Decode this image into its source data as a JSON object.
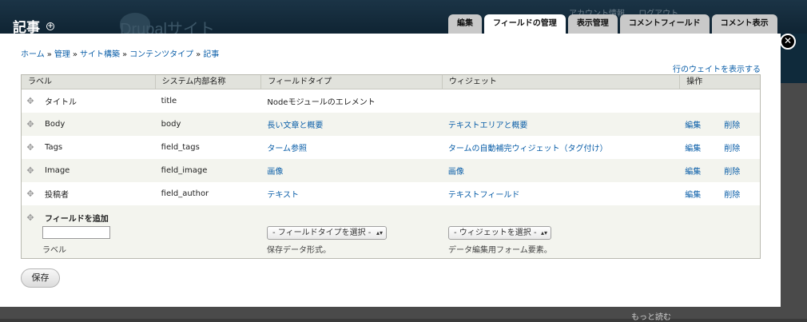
{
  "background": {
    "site_name": "Drupalサイト",
    "account_links": [
      "アカウント情報",
      "ログアウト"
    ],
    "read_more": "もっと読む"
  },
  "page": {
    "title": "記事",
    "shortcut_icon": "plus-circle-icon"
  },
  "tabs": [
    {
      "label": "編集",
      "active": false
    },
    {
      "label": "フィールドの管理",
      "active": true
    },
    {
      "label": "表示管理",
      "active": false
    },
    {
      "label": "コメントフィールド",
      "active": false
    },
    {
      "label": "コメント表示",
      "active": false
    }
  ],
  "close_icon": "close-x-icon",
  "breadcrumb": [
    "ホーム",
    "管理",
    "サイト構築",
    "コンテンツタイプ",
    "記事"
  ],
  "breadcrumb_sep": "»",
  "weight_toggle": "行のウェイトを表示する",
  "table": {
    "headers": [
      "ラベル",
      "システム内部名称",
      "フィールドタイプ",
      "ウィジェット",
      "操作"
    ],
    "rows": [
      {
        "label": "タイトル",
        "machine": "title",
        "type": "Nodeモジュールのエレメント",
        "widget": "",
        "edit": "",
        "delete": ""
      },
      {
        "label": "Body",
        "machine": "body",
        "type": "長い文章と概要",
        "widget": "テキストエリアと概要",
        "edit": "編集",
        "delete": "削除"
      },
      {
        "label": "Tags",
        "machine": "field_tags",
        "type": "ターム参照",
        "widget": "タームの自動補完ウィジェット（タグ付け）",
        "edit": "編集",
        "delete": "削除"
      },
      {
        "label": "Image",
        "machine": "field_image",
        "type": "画像",
        "widget": "画像",
        "edit": "編集",
        "delete": "削除"
      },
      {
        "label": "投稿者",
        "machine": "field_author",
        "type": "テキスト",
        "widget": "テキストフィールド",
        "edit": "編集",
        "delete": "削除"
      }
    ],
    "add_field": {
      "title": "フィールドを追加",
      "label_value": "",
      "label_desc": "ラベル",
      "type_select": "- フィールドタイプを選択 -",
      "type_desc": "保存データ形式。",
      "widget_select": "- ウィジェットを選択 -",
      "widget_desc": "データ編集用フォーム要素。"
    }
  },
  "save_label": "保存"
}
